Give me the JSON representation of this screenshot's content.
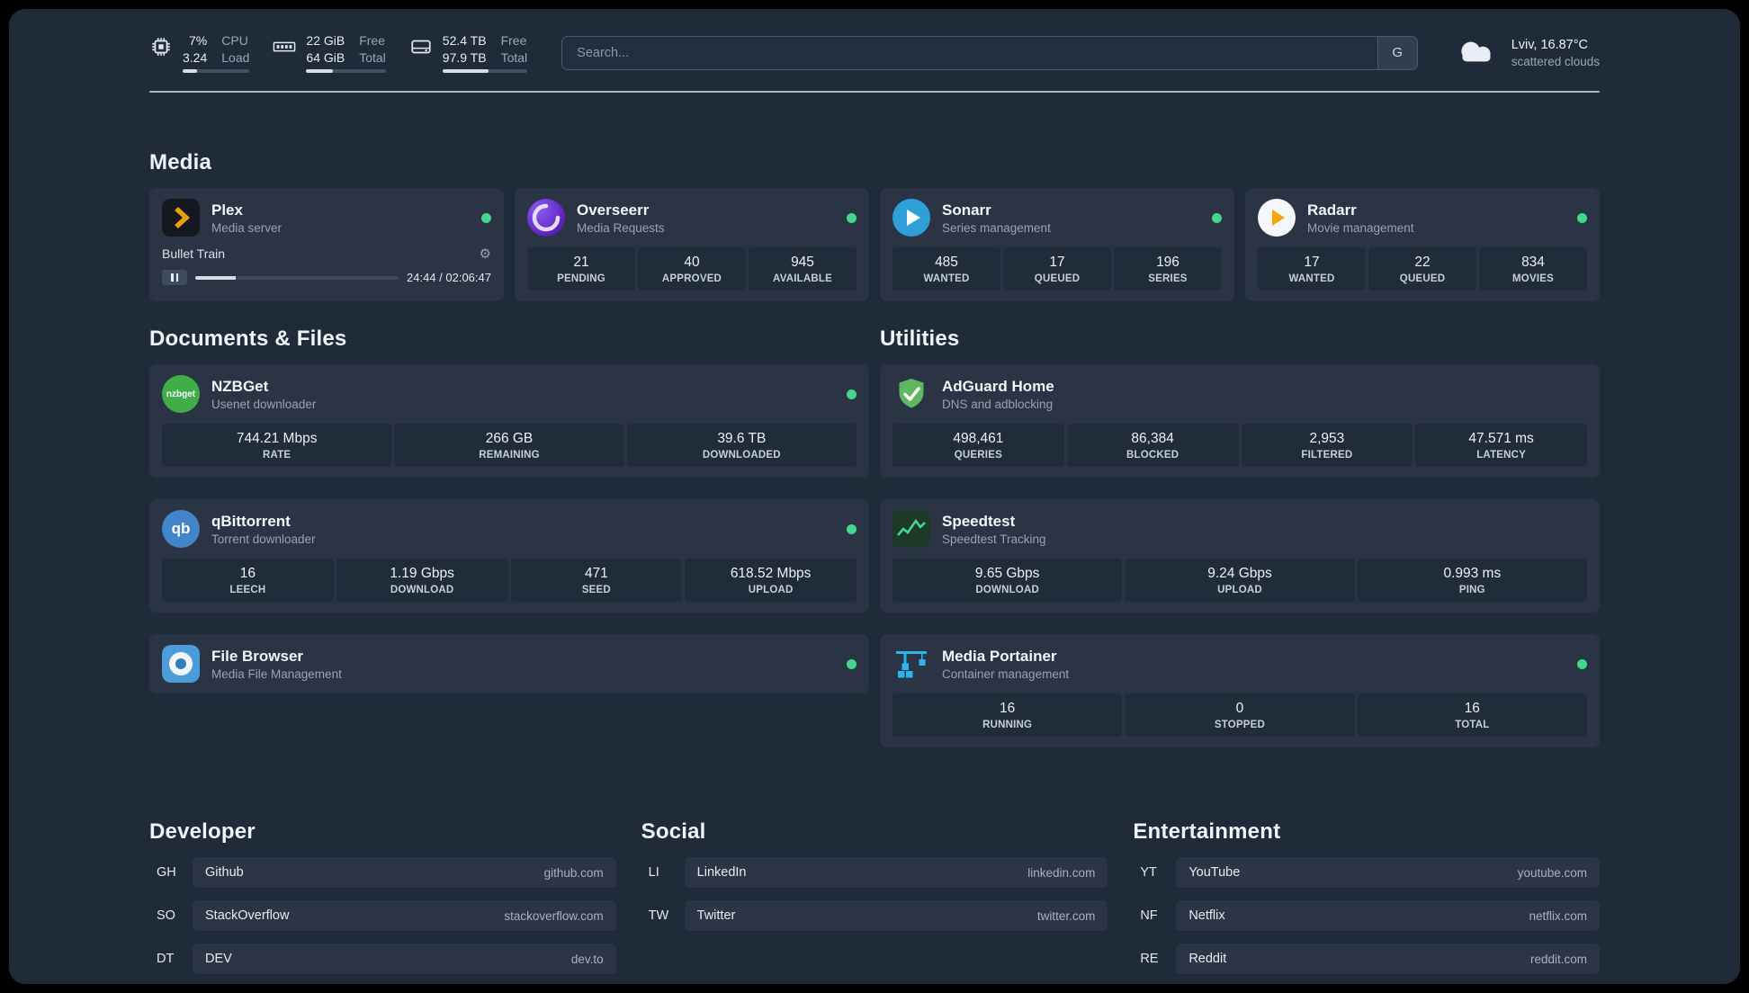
{
  "colors": {
    "status_green": "#43d78b",
    "panel_bg": "#202b3a",
    "card_bg": "#2a3444",
    "plex_accent": "#e5a00d"
  },
  "header": {
    "cpu": {
      "value1": "7%",
      "label1": "CPU",
      "value2": "3.24",
      "label2": "Load",
      "progress_pct": 22
    },
    "memory": {
      "value1": "22 GiB",
      "label1": "Free",
      "value2": "64 GiB",
      "label2": "Total",
      "progress_pct": 34
    },
    "disk": {
      "value1": "52.4 TB",
      "label1": "Free",
      "value2": "97.9 TB",
      "label2": "Total",
      "progress_pct": 54
    },
    "search": {
      "placeholder": "Search...",
      "provider_button": "G"
    },
    "weather": {
      "location": "Lviv, 16.87°C",
      "condition": "scattered clouds"
    }
  },
  "sections": {
    "media": "Media",
    "documents": "Documents & Files",
    "utilities": "Utilities",
    "developer": "Developer",
    "social": "Social",
    "entertainment": "Entertainment"
  },
  "services": {
    "plex": {
      "name": "Plex",
      "subtitle": "Media server",
      "now_playing": {
        "track": "Bullet Train",
        "time": "24:44 / 02:06:47",
        "progress_pct": 20
      }
    },
    "overseerr": {
      "name": "Overseerr",
      "subtitle": "Media Requests",
      "stats": [
        {
          "value": "21",
          "label": "PENDING"
        },
        {
          "value": "40",
          "label": "APPROVED"
        },
        {
          "value": "945",
          "label": "AVAILABLE"
        }
      ]
    },
    "sonarr": {
      "name": "Sonarr",
      "subtitle": "Series management",
      "stats": [
        {
          "value": "485",
          "label": "WANTED"
        },
        {
          "value": "17",
          "label": "QUEUED"
        },
        {
          "value": "196",
          "label": "SERIES"
        }
      ]
    },
    "radarr": {
      "name": "Radarr",
      "subtitle": "Movie management",
      "stats": [
        {
          "value": "17",
          "label": "WANTED"
        },
        {
          "value": "22",
          "label": "QUEUED"
        },
        {
          "value": "834",
          "label": "MOVIES"
        }
      ]
    },
    "nzbget": {
      "name": "NZBGet",
      "subtitle": "Usenet downloader",
      "icon_text": "nzbget",
      "stats": [
        {
          "value": "744.21 Mbps",
          "label": "RATE"
        },
        {
          "value": "266 GB",
          "label": "REMAINING"
        },
        {
          "value": "39.6 TB",
          "label": "DOWNLOADED"
        }
      ]
    },
    "qbittorrent": {
      "name": "qBittorrent",
      "subtitle": "Torrent downloader",
      "icon_text": "qb",
      "stats": [
        {
          "value": "16",
          "label": "LEECH"
        },
        {
          "value": "1.19 Gbps",
          "label": "DOWNLOAD"
        },
        {
          "value": "471",
          "label": "SEED"
        },
        {
          "value": "618.52 Mbps",
          "label": "UPLOAD"
        }
      ]
    },
    "filebrowser": {
      "name": "File Browser",
      "subtitle": "Media File Management"
    },
    "adguard": {
      "name": "AdGuard Home",
      "subtitle": "DNS and adblocking",
      "stats": [
        {
          "value": "498,461",
          "label": "QUERIES"
        },
        {
          "value": "86,384",
          "label": "BLOCKED"
        },
        {
          "value": "2,953",
          "label": "FILTERED"
        },
        {
          "value": "47.571 ms",
          "label": "LATENCY"
        }
      ]
    },
    "speedtest": {
      "name": "Speedtest",
      "subtitle": "Speedtest Tracking",
      "stats": [
        {
          "value": "9.65 Gbps",
          "label": "DOWNLOAD"
        },
        {
          "value": "9.24 Gbps",
          "label": "UPLOAD"
        },
        {
          "value": "0.993 ms",
          "label": "PING"
        }
      ]
    },
    "portainer": {
      "name": "Media Portainer",
      "subtitle": "Container management",
      "stats": [
        {
          "value": "16",
          "label": "RUNNING"
        },
        {
          "value": "0",
          "label": "STOPPED"
        },
        {
          "value": "16",
          "label": "TOTAL"
        }
      ]
    }
  },
  "bookmarks": {
    "developer": [
      {
        "abbr": "GH",
        "name": "Github",
        "url": "github.com"
      },
      {
        "abbr": "SO",
        "name": "StackOverflow",
        "url": "stackoverflow.com"
      },
      {
        "abbr": "DT",
        "name": "DEV",
        "url": "dev.to"
      }
    ],
    "social": [
      {
        "abbr": "LI",
        "name": "LinkedIn",
        "url": "linkedin.com"
      },
      {
        "abbr": "TW",
        "name": "Twitter",
        "url": "twitter.com"
      }
    ],
    "entertainment": [
      {
        "abbr": "YT",
        "name": "YouTube",
        "url": "youtube.com"
      },
      {
        "abbr": "NF",
        "name": "Netflix",
        "url": "netflix.com"
      },
      {
        "abbr": "RE",
        "name": "Reddit",
        "url": "reddit.com"
      }
    ]
  }
}
